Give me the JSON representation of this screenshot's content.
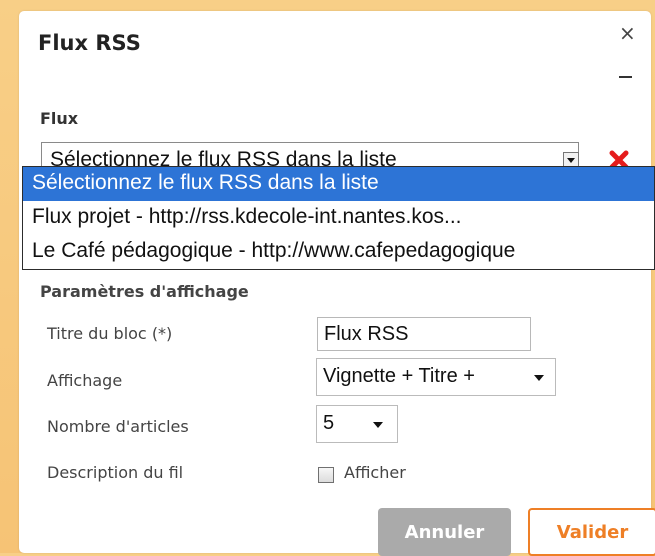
{
  "dialog": {
    "title": "Flux RSS"
  },
  "flux": {
    "section_label": "Flux",
    "select_value": "Sélectionnez le flux RSS dans la liste",
    "options": [
      "Sélectionnez le flux RSS dans la liste",
      "Flux projet - http://rss.kdecole-int.nantes.kos...",
      "Le Café pédagogique - http://www.cafepedagogique"
    ]
  },
  "display_settings": {
    "section_label": "Paramètres d'affichage",
    "block_title_label": "Titre du bloc (*)",
    "block_title_value": "Flux RSS",
    "display_label": "Affichage",
    "display_value": "Vignette + Titre +",
    "article_count_label": "Nombre d'articles",
    "article_count_value": "5",
    "description_label": "Description du fil",
    "show_label": "Afficher"
  },
  "buttons": {
    "cancel": "Annuler",
    "validate": "Valider"
  },
  "icons": {
    "close": "close-icon",
    "minimize": "minimize-icon",
    "delete": "delete-icon",
    "dropdown": "chevron-down-icon"
  },
  "colors": {
    "background": "#f7c97d",
    "accent": "#ee7f26",
    "selection": "#2d74d6",
    "delete": "#e51c1c",
    "disabled_button": "#aaaaaa"
  }
}
